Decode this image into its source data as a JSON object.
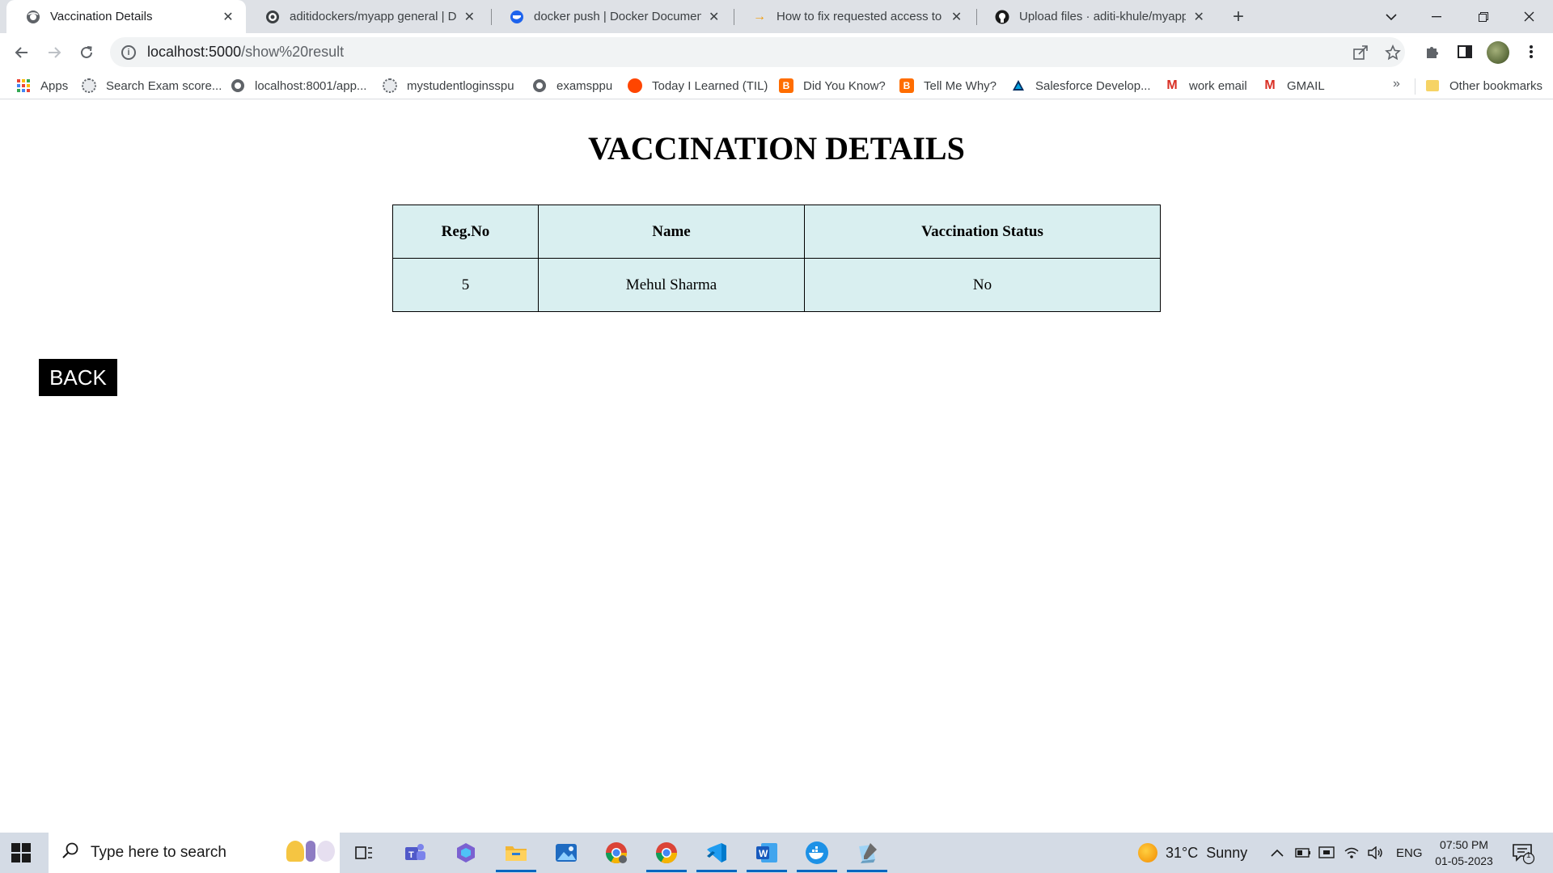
{
  "browser": {
    "tabs": [
      {
        "title": "Vaccination Details",
        "icon": "globe-icon",
        "active": true
      },
      {
        "title": "aditidockers/myapp general | Do",
        "icon": "docker-icon",
        "active": false
      },
      {
        "title": "docker push | Docker Documenta",
        "icon": "docker-docs-icon",
        "active": false
      },
      {
        "title": "How to fix requested access to th",
        "icon": "arrow-icon",
        "active": false
      },
      {
        "title": "Upload files · aditi-khule/myapp",
        "icon": "github-icon",
        "active": false
      }
    ],
    "address": {
      "host": "localhost:5000",
      "path": "/show%20result"
    },
    "bookmarks": [
      {
        "label": "Apps",
        "icon": "apps-grid-icon"
      },
      {
        "label": "Search Exam score...",
        "icon": "seal-icon"
      },
      {
        "label": "localhost:8001/app...",
        "icon": "globe-icon"
      },
      {
        "label": "mystudentloginsspu",
        "icon": "seal-icon"
      },
      {
        "label": "examsppu",
        "icon": "globe-icon"
      },
      {
        "label": "Today I Learned (TIL)",
        "icon": "reddit-icon"
      },
      {
        "label": "Did You Know?",
        "icon": "blogger-icon"
      },
      {
        "label": "Tell Me Why?",
        "icon": "blogger-icon"
      },
      {
        "label": "Salesforce Develop...",
        "icon": "salesforce-icon"
      },
      {
        "label": "work email",
        "icon": "gmail-icon"
      },
      {
        "label": "GMAIL",
        "icon": "gmail-icon"
      }
    ],
    "other_bookmarks": "Other bookmarks",
    "overflow": "»"
  },
  "page": {
    "title": "VACCINATION DETAILS",
    "table": {
      "headers": [
        "Reg.No",
        "Name",
        "Vaccination Status"
      ],
      "rows": [
        [
          "5",
          "Mehul Sharma",
          "No"
        ]
      ]
    },
    "back_label": "BACK"
  },
  "taskbar": {
    "search_placeholder": "Type here to search",
    "weather": "31°C  Sunny",
    "language": "ENG",
    "time": "07:50 PM",
    "date": "01-05-2023",
    "notification_count": "1"
  },
  "colors": {
    "table_bg": "#d9eff0",
    "button_bg": "#000000",
    "tab_strip": "#dee1e6"
  }
}
